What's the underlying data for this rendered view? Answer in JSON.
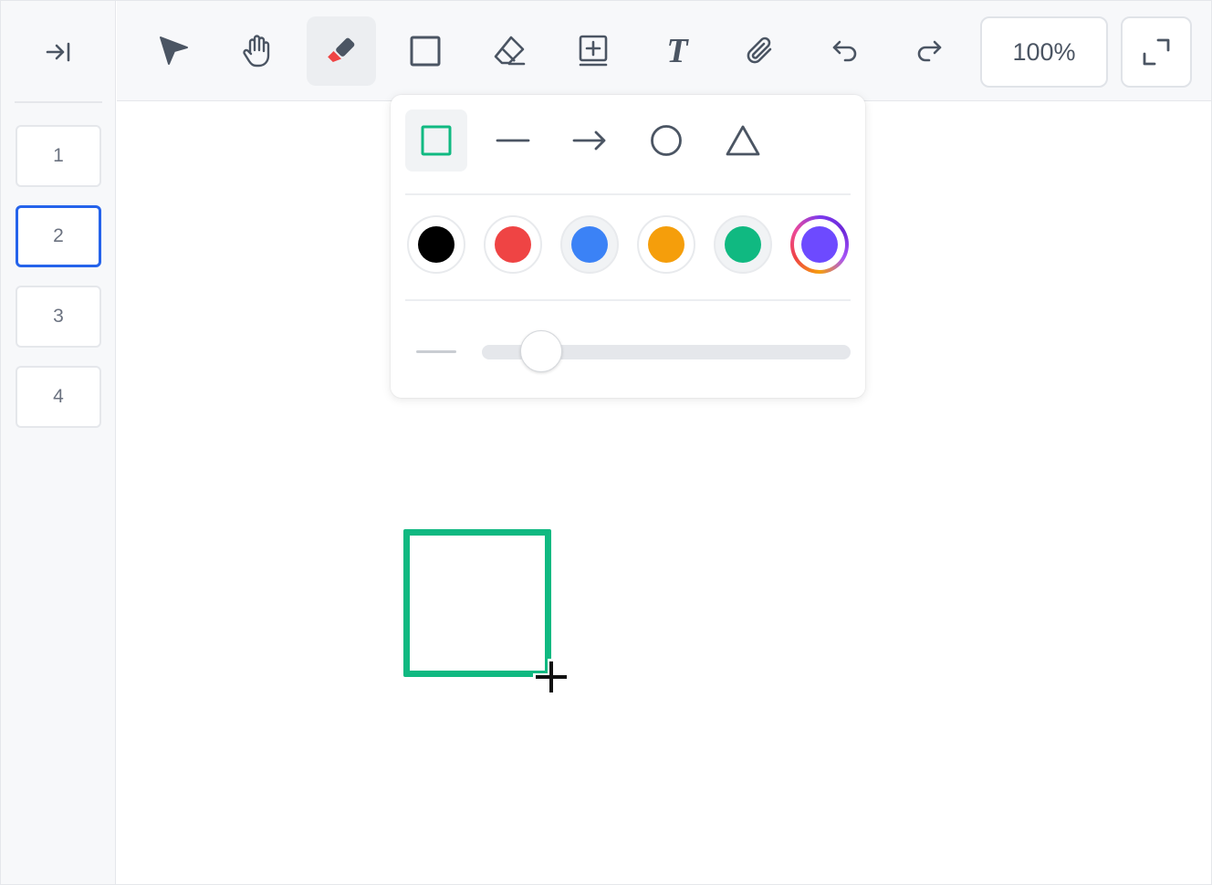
{
  "sidebar": {
    "collapse_icon": "collapse-sidebar-icon",
    "pages": [
      {
        "label": "1",
        "active": false
      },
      {
        "label": "2",
        "active": true
      },
      {
        "label": "3",
        "active": false
      },
      {
        "label": "4",
        "active": false
      }
    ]
  },
  "toolbar": {
    "tools": [
      {
        "name": "select",
        "icon": "pointer-arrow-icon"
      },
      {
        "name": "pan",
        "icon": "hand-icon"
      },
      {
        "name": "marker",
        "icon": "marker-icon",
        "active": true
      },
      {
        "name": "shape",
        "icon": "square-icon"
      },
      {
        "name": "eraser",
        "icon": "eraser-icon"
      },
      {
        "name": "add-page",
        "icon": "add-page-icon"
      },
      {
        "name": "text",
        "icon": "text-icon",
        "glyph": "T"
      },
      {
        "name": "attach",
        "icon": "paperclip-icon"
      },
      {
        "name": "undo",
        "icon": "undo-icon"
      },
      {
        "name": "redo",
        "icon": "redo-icon"
      }
    ],
    "zoom_label": "100%",
    "fullscreen_icon": "fullscreen-icon"
  },
  "shape_popover": {
    "shapes": [
      "rectangle",
      "line",
      "arrow",
      "circle",
      "triangle"
    ],
    "selected_shape": "rectangle",
    "colors": [
      "#000000",
      "#ef4444",
      "#3b82f6",
      "#f59e0b",
      "#10b981",
      "#6d4aff"
    ],
    "selected_color": "#6d4aff",
    "stroke_width_fraction": 0.16
  },
  "canvas": {
    "drawn_shape": {
      "type": "rectangle",
      "color": "#10b981"
    },
    "cursor": "crosshair-plus"
  },
  "colors": {
    "accent": "#2563eb",
    "marker_tip": "#ef4444",
    "icon": "#4b5563"
  }
}
